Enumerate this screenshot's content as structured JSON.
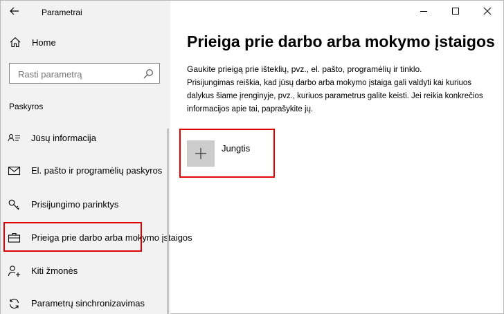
{
  "window": {
    "title": "Parametrai"
  },
  "sidebar": {
    "home_label": "Home",
    "search_placeholder": "Rasti parametrą",
    "section_label": "Paskyros",
    "items": [
      {
        "label": "Jūsų informacija",
        "icon": "person-card-icon"
      },
      {
        "label": "El. pašto ir programėlių paskyros",
        "icon": "mail-icon"
      },
      {
        "label": "Prisijungimo parinktys",
        "icon": "key-icon"
      },
      {
        "label": "Prieiga prie darbo arba mokymo įstaigos",
        "icon": "briefcase-icon",
        "active": true
      },
      {
        "label": "Kiti žmonės",
        "icon": "person-add-icon"
      },
      {
        "label": "Parametrų sinchronizavimas",
        "icon": "sync-icon"
      }
    ]
  },
  "main": {
    "title": "Prieiga prie darbo arba mokymo įstaigos",
    "description_1": "Gaukite prieigą prie išteklių, pvz., el. pašto, programėlių ir tinklo.",
    "description_2": "Prisijungimas reiškia, kad jūsų darbo arba mokymo įstaiga gali valdyti kai kuriuos dalykus šiame įrenginyje, pvz., kuriuos parametrus galite keisti. Jei reikia konkrečios informacijos apie tai, paprašykite jų.",
    "connect_label": "Jungtis"
  },
  "colors": {
    "sidebar_bg": "#f2f2f2",
    "highlight": "#e00000",
    "tile_bg": "#cccccc"
  }
}
